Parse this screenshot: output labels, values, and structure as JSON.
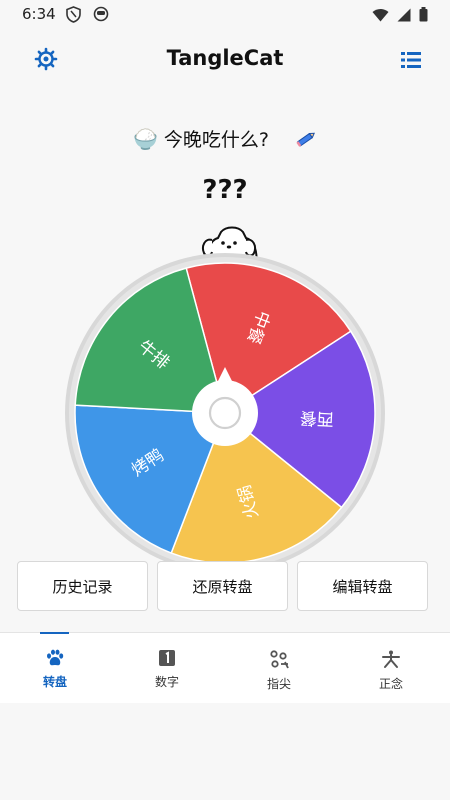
{
  "status_bar": {
    "time": "6:34"
  },
  "app": {
    "title": "TangleCat"
  },
  "question": {
    "text": "今晚吃什么?"
  },
  "result": {
    "text": "???"
  },
  "wheel": {
    "segments": [
      {
        "label": "中餐",
        "color": "#e84a4a"
      },
      {
        "label": "西餐",
        "color": "#7b4ee6"
      },
      {
        "label": "火锅",
        "color": "#f6c44f"
      },
      {
        "label": "烤鸭",
        "color": "#3f96e8"
      },
      {
        "label": "牛排",
        "color": "#3ea764"
      }
    ]
  },
  "actions": {
    "history": "历史记录",
    "reset": "还原转盘",
    "edit": "编辑转盘"
  },
  "nav": [
    {
      "label": "转盘",
      "icon": "paw-icon",
      "active": true
    },
    {
      "label": "数字",
      "icon": "number-one-icon",
      "active": false
    },
    {
      "label": "指尖",
      "icon": "fingertip-icon",
      "active": false
    },
    {
      "label": "正念",
      "icon": "mindfulness-icon",
      "active": false
    }
  ],
  "colors": {
    "accent": "#1565c0",
    "background": "#f7f7f7"
  }
}
